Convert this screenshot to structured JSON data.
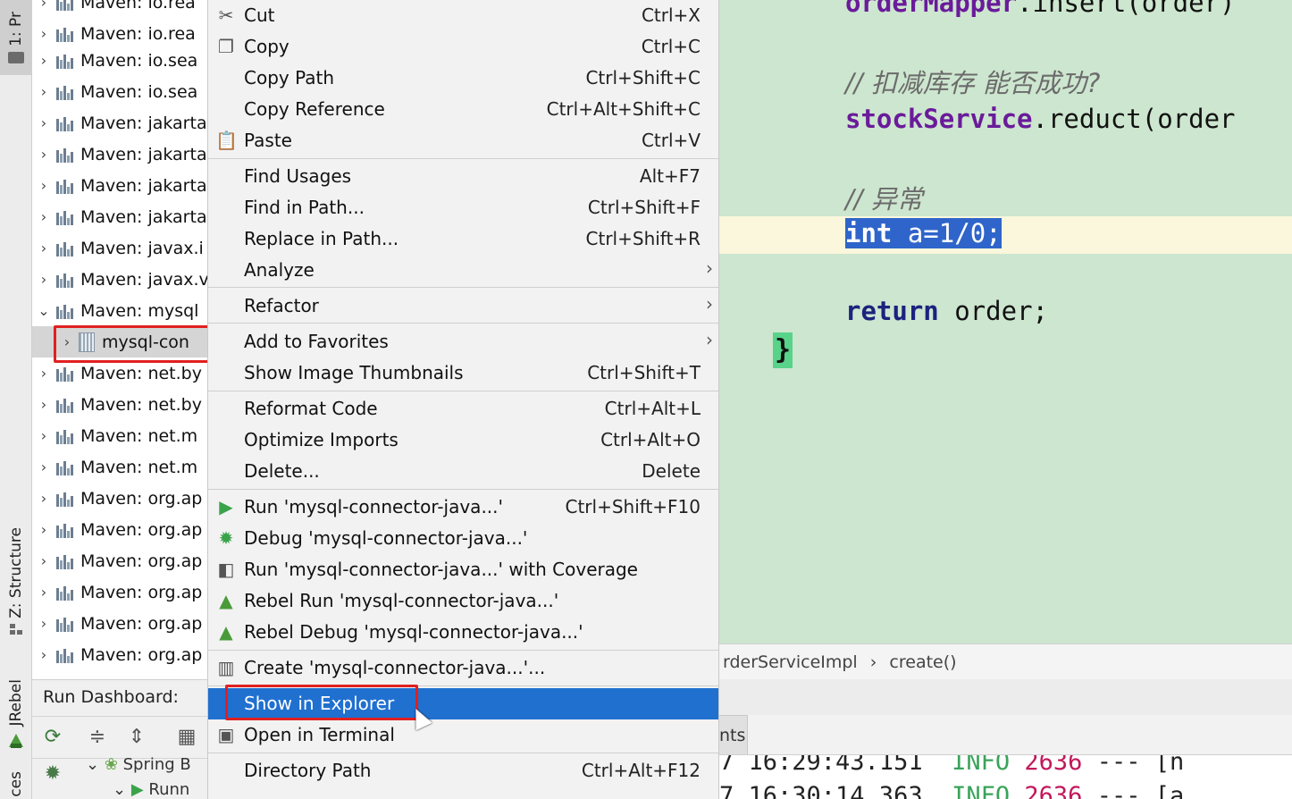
{
  "tool_strip": {
    "project_tab": "1: Pr",
    "structure_tab": "Z: Structure",
    "jrebel_tab": "JRebel",
    "services_tab": "ces"
  },
  "tree": {
    "rows": [
      {
        "label": "Maven: io.rea",
        "expanded": false
      },
      {
        "label": "Maven: io.rea",
        "expanded": false
      },
      {
        "label": "Maven: io.sea",
        "expanded": false
      },
      {
        "label": "Maven: io.sea",
        "expanded": false
      },
      {
        "label": "Maven: jakarta",
        "expanded": false
      },
      {
        "label": "Maven: jakarta",
        "expanded": false
      },
      {
        "label": "Maven: jakarta",
        "expanded": false
      },
      {
        "label": "Maven: jakarta",
        "expanded": false
      },
      {
        "label": "Maven: javax.i",
        "expanded": false
      },
      {
        "label": "Maven: javax.v",
        "expanded": false
      },
      {
        "label": "Maven: mysql",
        "expanded": true
      },
      {
        "label": "mysql-con",
        "expanded": false,
        "child": true,
        "selected": true
      },
      {
        "label": "Maven: net.by",
        "expanded": false
      },
      {
        "label": "Maven: net.by",
        "expanded": false
      },
      {
        "label": "Maven: net.m",
        "expanded": false
      },
      {
        "label": "Maven: net.m",
        "expanded": false
      },
      {
        "label": "Maven: org.ap",
        "expanded": false
      },
      {
        "label": "Maven: org.ap",
        "expanded": false
      },
      {
        "label": "Maven: org.ap",
        "expanded": false
      },
      {
        "label": "Maven: org.ap",
        "expanded": false
      },
      {
        "label": "Maven: org.ap",
        "expanded": false
      },
      {
        "label": "Maven: org.ap",
        "expanded": false
      }
    ]
  },
  "run_dashboard": {
    "title": "Run Dashboard:",
    "tree_line_1": "Spring B",
    "tree_line_2": "Runn"
  },
  "editor": {
    "line_insert_field": "orderMapper",
    "line_insert_rest": ".insert(order)",
    "comment_1": "// 扣减库存 能否成功?",
    "line_reduct_field": "stockService",
    "line_reduct_rest": ".reduct(order",
    "comment_2": "// 异常",
    "line_int_kw": "int",
    "line_int_rest": " a=1/0;",
    "line_return_kw": "return",
    "line_return_rest": " order;",
    "closing_brace": "}"
  },
  "breadcrumb": {
    "class": "rderServiceImpl",
    "sep": "›",
    "method": "create()"
  },
  "bottom": {
    "events_tab": "nts"
  },
  "console": {
    "line1_time": "7 16:29:43.151",
    "line1_level": "INFO",
    "line1_pid": "2636",
    "line1_rest": "--- [n",
    "line2_time": "7 16:30:14.363",
    "line2_level": "INFO",
    "line2_pid": "2636",
    "line2_rest": "--- [a"
  },
  "menu": {
    "items": [
      {
        "label": "Cut",
        "shortcut": "Ctrl+X",
        "icon": "scissors-icon"
      },
      {
        "label": "Copy",
        "shortcut": "Ctrl+C",
        "icon": "copy-icon"
      },
      {
        "label": "Copy Path",
        "shortcut": "Ctrl+Shift+C"
      },
      {
        "label": "Copy Reference",
        "shortcut": "Ctrl+Alt+Shift+C"
      },
      {
        "label": "Paste",
        "shortcut": "Ctrl+V",
        "icon": "paste-icon"
      },
      {
        "label": "Find Usages",
        "shortcut": "Alt+F7"
      },
      {
        "label": "Find in Path...",
        "shortcut": "Ctrl+Shift+F"
      },
      {
        "label": "Replace in Path...",
        "shortcut": "Ctrl+Shift+R"
      },
      {
        "label": "Analyze",
        "submenu": true
      },
      {
        "label": "Refactor",
        "submenu": true
      },
      {
        "label": "Add to Favorites",
        "submenu": true
      },
      {
        "label": "Show Image Thumbnails",
        "shortcut": "Ctrl+Shift+T"
      },
      {
        "label": "Reformat Code",
        "shortcut": "Ctrl+Alt+L"
      },
      {
        "label": "Optimize Imports",
        "shortcut": "Ctrl+Alt+O"
      },
      {
        "label": "Delete...",
        "shortcut": "Delete"
      },
      {
        "label": "Run 'mysql-connector-java...'",
        "shortcut": "Ctrl+Shift+F10",
        "icon": "run-icon"
      },
      {
        "label": "Debug 'mysql-connector-java...'",
        "icon": "debug-icon"
      },
      {
        "label": "Run 'mysql-connector-java...' with Coverage",
        "icon": "coverage-icon"
      },
      {
        "label": "Rebel Run 'mysql-connector-java...'",
        "icon": "rebel-run-icon"
      },
      {
        "label": "Rebel Debug 'mysql-connector-java...'",
        "icon": "rebel-debug-icon"
      },
      {
        "label": "Create 'mysql-connector-java...'...",
        "icon": "create-config-icon"
      },
      {
        "label": "Show in Explorer",
        "active": true
      },
      {
        "label": "Open in Terminal",
        "icon": "terminal-icon"
      },
      {
        "label": "Directory Path",
        "shortcut": "Ctrl+Alt+F12"
      }
    ]
  },
  "colors": {
    "menu_active": "#2070d0",
    "editor_bg": "#cde6cf",
    "highlight_box": "#e02020",
    "selection": "#2f65ca"
  }
}
